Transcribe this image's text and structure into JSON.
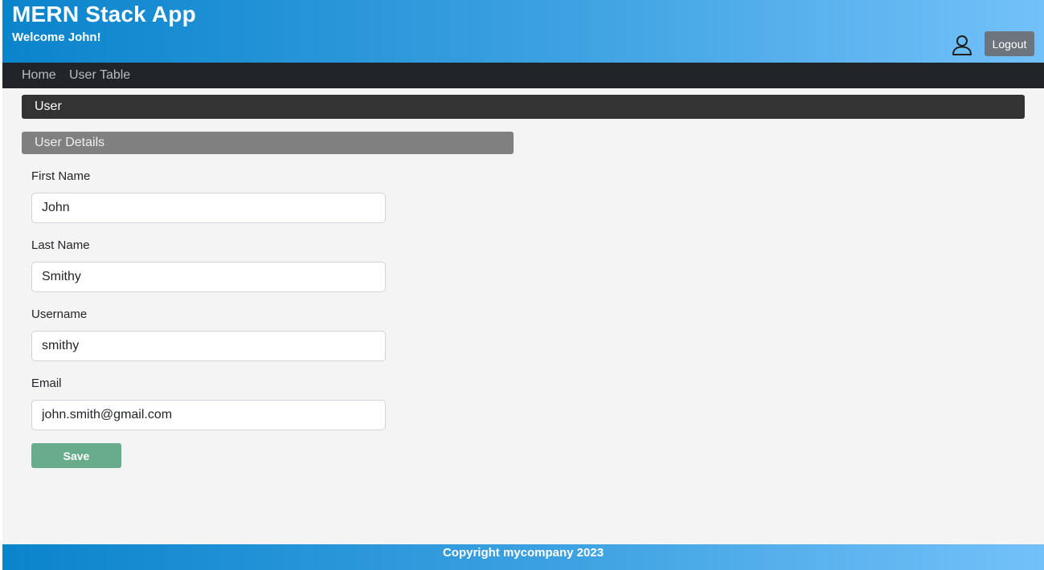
{
  "header": {
    "title": "MERN Stack App",
    "welcome": "Welcome John!",
    "user_icon": "user-icon",
    "logout_label": "Logout"
  },
  "nav": {
    "items": [
      {
        "label": "Home"
      },
      {
        "label": "User Table"
      }
    ]
  },
  "section": {
    "title": "User"
  },
  "details": {
    "title": "User Details",
    "fields": [
      {
        "label": "First Name",
        "value": "John"
      },
      {
        "label": "Last Name",
        "value": "Smithy"
      },
      {
        "label": "Username",
        "value": "smithy"
      },
      {
        "label": "Email",
        "value": "john.smith@gmail.com"
      }
    ],
    "save_label": "Save"
  },
  "footer": {
    "text": "Copyright mycompany 2023"
  },
  "colors": {
    "header_gradient_start": "#0a84cc",
    "header_gradient_end": "#73c1f9",
    "navbar": "#212529",
    "section_bar": "#333333",
    "details_bar": "#808080",
    "logout_button": "#6c757d",
    "save_button": "#67ad8c",
    "page_background": "#f4f4f4"
  }
}
